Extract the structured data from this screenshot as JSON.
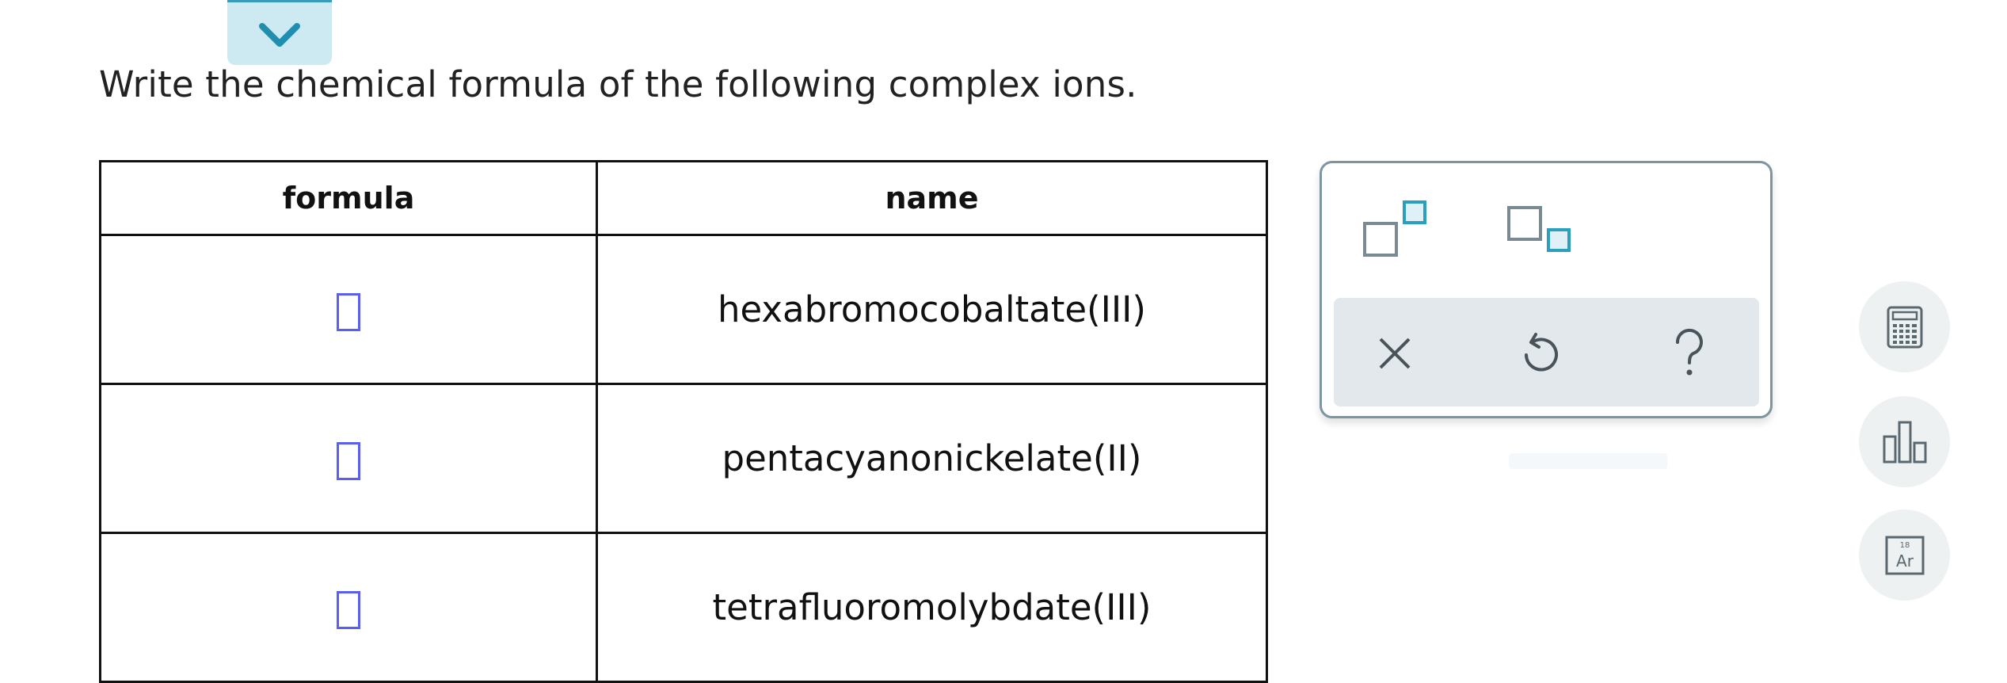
{
  "prompt": "Write the chemical formula of the following complex ions.",
  "table": {
    "headers": [
      "formula",
      "name"
    ],
    "rows": [
      {
        "name": "hexabromocobaltate(III)"
      },
      {
        "name": "pentacyanonickelate(II)"
      },
      {
        "name": "tetrafluoromolybdate(III)"
      }
    ]
  },
  "palette": {
    "templates": [
      "superscript-template-icon",
      "subscript-template-icon"
    ],
    "actions": [
      "clear-icon",
      "undo-icon",
      "help-icon"
    ]
  },
  "tools": [
    "calculator-icon",
    "bar-chart-icon",
    "periodic-table-icon"
  ],
  "periodic_icon": {
    "number": "18",
    "symbol": "Ar"
  },
  "colors": {
    "accent": "#3a9cb6",
    "input_border": "#5a5ff0",
    "palette_border": "#7d95a1",
    "action_bar": "#e2e8eb"
  }
}
